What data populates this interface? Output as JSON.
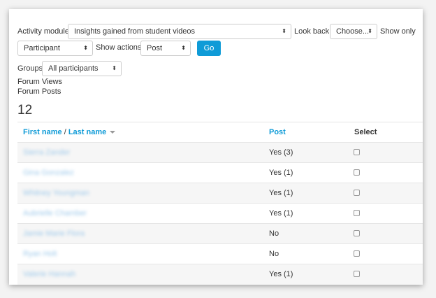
{
  "filters": {
    "activity_module_label": "Activity module",
    "activity_module_value": "Insights gained from student videos",
    "look_back_label": "Look back",
    "look_back_value": "Choose...",
    "show_only_label": "Show only",
    "show_only_value": "Participant",
    "show_actions_label": "Show actions",
    "show_actions_value": "Post",
    "go_label": "Go",
    "groups_label": "Groups",
    "groups_value": "All participants"
  },
  "report": {
    "line1": "Forum Views",
    "line2": "Forum Posts",
    "count": "12"
  },
  "table": {
    "col_first_name": "First name",
    "col_separator": " / ",
    "col_last_name": "Last name",
    "col_post": "Post",
    "col_select": "Select",
    "rows": [
      {
        "name": "Sierra Zander",
        "post": "Yes (3)"
      },
      {
        "name": "Gina Gonzalez",
        "post": "Yes (1)"
      },
      {
        "name": "Whitney Youngman",
        "post": "Yes (1)"
      },
      {
        "name": "Aubrielle Chamber",
        "post": "Yes (1)"
      },
      {
        "name": "Jamie Marie Flora",
        "post": "No"
      },
      {
        "name": "Ryan Holt",
        "post": "No"
      },
      {
        "name": "Valerie Hannah",
        "post": "Yes (1)"
      }
    ]
  },
  "icons": {
    "select_caret": "up-down-caret-icon",
    "sort": "sort-desc-icon"
  },
  "colors": {
    "accent": "#0f9bd7",
    "row_stripe": "#f6f6f6"
  }
}
